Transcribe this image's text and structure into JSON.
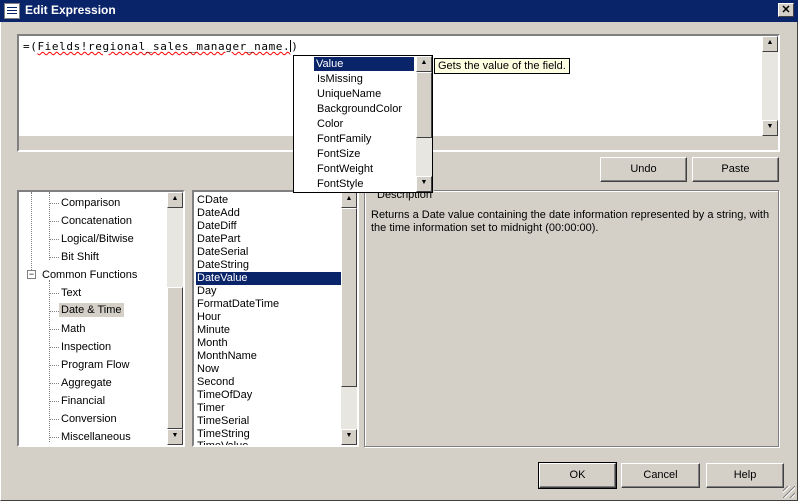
{
  "window": {
    "title": "Edit Expression",
    "close_glyph": "✕"
  },
  "editor": {
    "prefix": "=(",
    "expression": "Fields!regional_sales_manager_name.",
    "suffix": ")"
  },
  "intellisense": {
    "items": [
      "Value",
      "IsMissing",
      "UniqueName",
      "BackgroundColor",
      "Color",
      "FontFamily",
      "FontSize",
      "FontWeight",
      "FontStyle"
    ],
    "selected_index": 0,
    "tooltip": "Gets the value of the field."
  },
  "buttons": {
    "undo": "Undo",
    "paste": "Paste",
    "ok": "OK",
    "cancel": "Cancel",
    "help": "Help"
  },
  "tree": {
    "operators_children": [
      "Comparison",
      "Concatenation",
      "Logical/Bitwise",
      "Bit Shift"
    ],
    "common_functions": {
      "label": "Common Functions",
      "expander": "−"
    },
    "functions_children": [
      "Text",
      "Date & Time",
      "Math",
      "Inspection",
      "Program Flow",
      "Aggregate",
      "Financial",
      "Conversion",
      "Miscellaneous"
    ],
    "selected": "Date & Time"
  },
  "function_list": {
    "items": [
      "CDate",
      "DateAdd",
      "DateDiff",
      "DatePart",
      "DateSerial",
      "DateString",
      "DateValue",
      "Day",
      "FormatDateTime",
      "Hour",
      "Minute",
      "Month",
      "MonthName",
      "Now",
      "Second",
      "TimeOfDay",
      "Timer",
      "TimeSerial",
      "TimeString",
      "TimeValue"
    ],
    "selected": "DateValue"
  },
  "description": {
    "legend": "Description",
    "text": "Returns a Date value containing the date information represented by a string, with the time information set to midnight (00:00:00)."
  },
  "scroll": {
    "up": "▲",
    "down": "▼"
  }
}
